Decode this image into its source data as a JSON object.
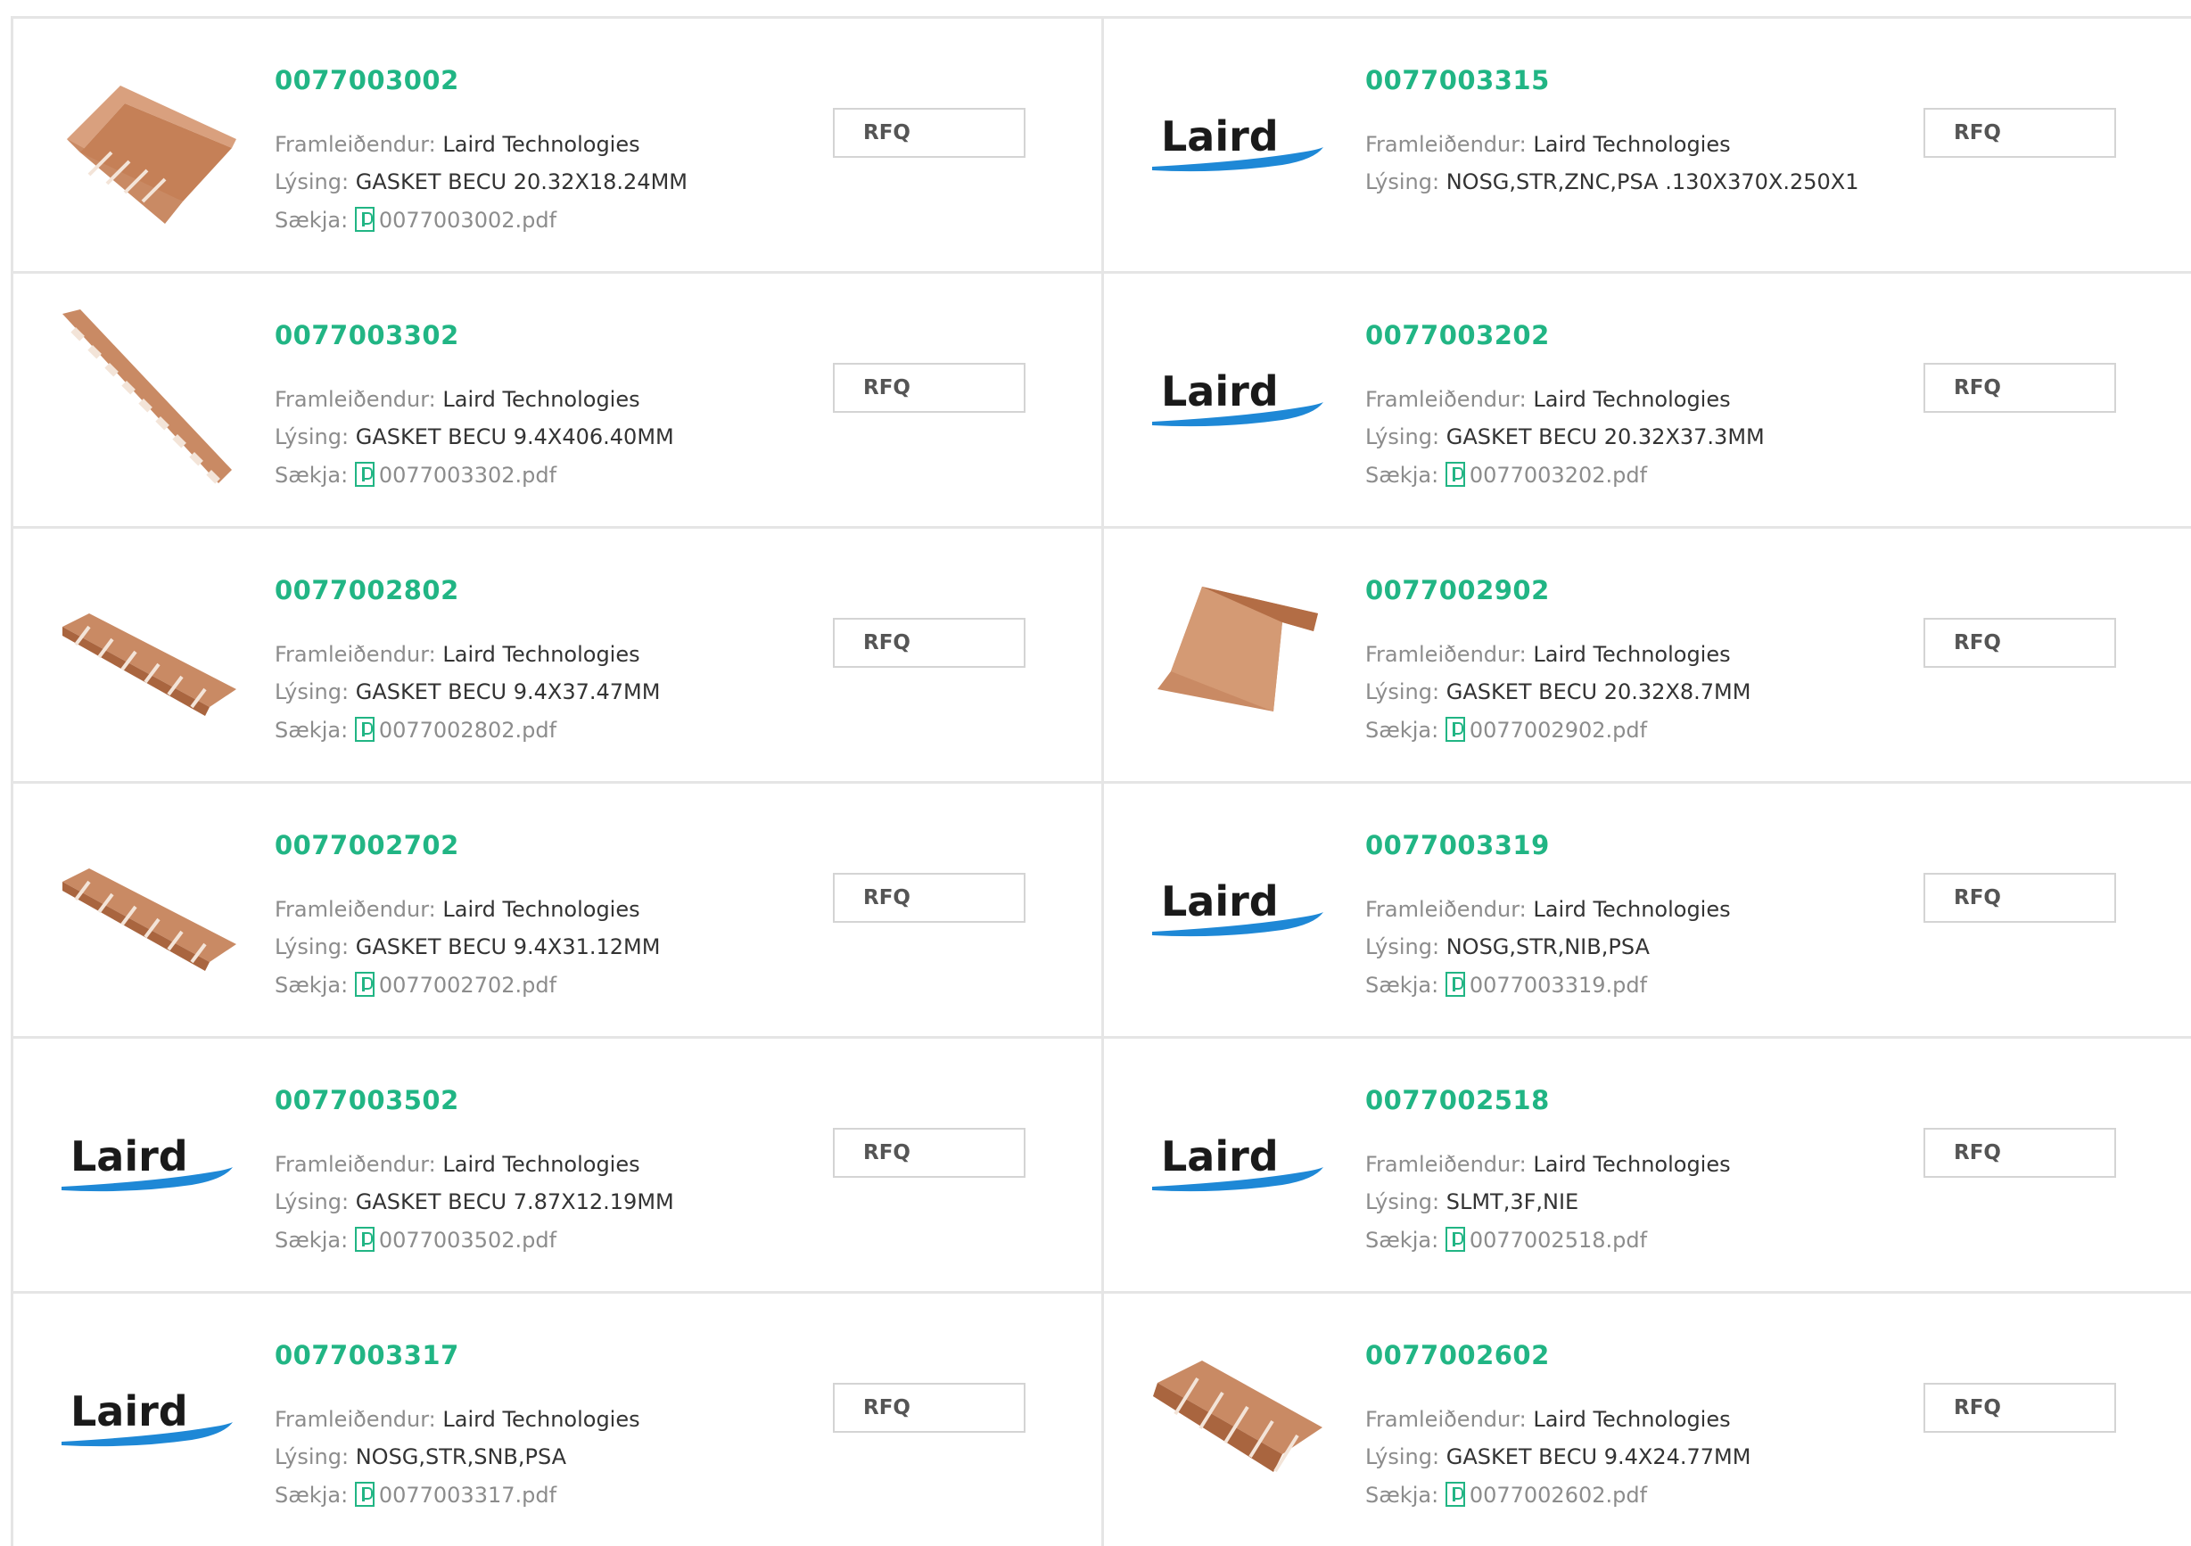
{
  "labels": {
    "manufacturer": "Framleiðendur:",
    "description": "Lýsing:",
    "download": "Sækja:",
    "rfq": "RFQ"
  },
  "products": [
    {
      "pn": "0077003002",
      "manufacturer": "Laird Technologies",
      "description": "GASKET BECU 20.32X18.24MM",
      "pdf": "0077003002.pdf",
      "image": "copper-gasket-wide"
    },
    {
      "pn": "0077003315",
      "manufacturer": "Laird Technologies",
      "description": "NOSG,STR,ZNC,PSA .130X370X.250X1",
      "pdf": "",
      "image": "laird-logo",
      "logo_text": "Laird"
    },
    {
      "pn": "0077003302",
      "manufacturer": "Laird Technologies",
      "description": "GASKET BECU 9.4X406.40MM",
      "pdf": "0077003302.pdf",
      "image": "copper-gasket-long-strip"
    },
    {
      "pn": "0077003202",
      "manufacturer": "Laird Technologies",
      "description": "GASKET BECU 20.32X37.3MM",
      "pdf": "0077003202.pdf",
      "image": "laird-logo",
      "logo_text": "Laird"
    },
    {
      "pn": "0077002802",
      "manufacturer": "Laird Technologies",
      "description": "GASKET BECU 9.4X37.47MM",
      "pdf": "0077002802.pdf",
      "image": "copper-gasket-strip"
    },
    {
      "pn": "0077002902",
      "manufacturer": "Laird Technologies",
      "description": "GASKET BECU 20.32X8.7MM",
      "pdf": "0077002902.pdf",
      "image": "copper-gasket-clip"
    },
    {
      "pn": "0077002702",
      "manufacturer": "Laird Technologies",
      "description": "GASKET BECU 9.4X31.12MM",
      "pdf": "0077002702.pdf",
      "image": "copper-gasket-strip"
    },
    {
      "pn": "0077003319",
      "manufacturer": "Laird Technologies",
      "description": "NOSG,STR,NIB,PSA",
      "pdf": "0077003319.pdf",
      "image": "laird-logo",
      "logo_text": "Laird"
    },
    {
      "pn": "0077003502",
      "manufacturer": "Laird Technologies",
      "description": "GASKET BECU 7.87X12.19MM",
      "pdf": "0077003502.pdf",
      "image": "laird-logo",
      "logo_text": "Laird"
    },
    {
      "pn": "0077002518",
      "manufacturer": "Laird Technologies",
      "description": "SLMT,3F,NIE",
      "pdf": "0077002518.pdf",
      "image": "laird-logo",
      "logo_text": "Laird"
    },
    {
      "pn": "0077003317",
      "manufacturer": "Laird Technologies",
      "description": "NOSG,STR,SNB,PSA",
      "pdf": "0077003317.pdf",
      "image": "laird-logo",
      "logo_text": "Laird"
    },
    {
      "pn": "0077002602",
      "manufacturer": "Laird Technologies",
      "description": "GASKET BECU 9.4X24.77MM",
      "pdf": "0077002602.pdf",
      "image": "copper-gasket-short-strip"
    }
  ],
  "colors": {
    "accent": "#21b584",
    "copper": "#c98a64",
    "logo_blue": "#1e88d6"
  }
}
